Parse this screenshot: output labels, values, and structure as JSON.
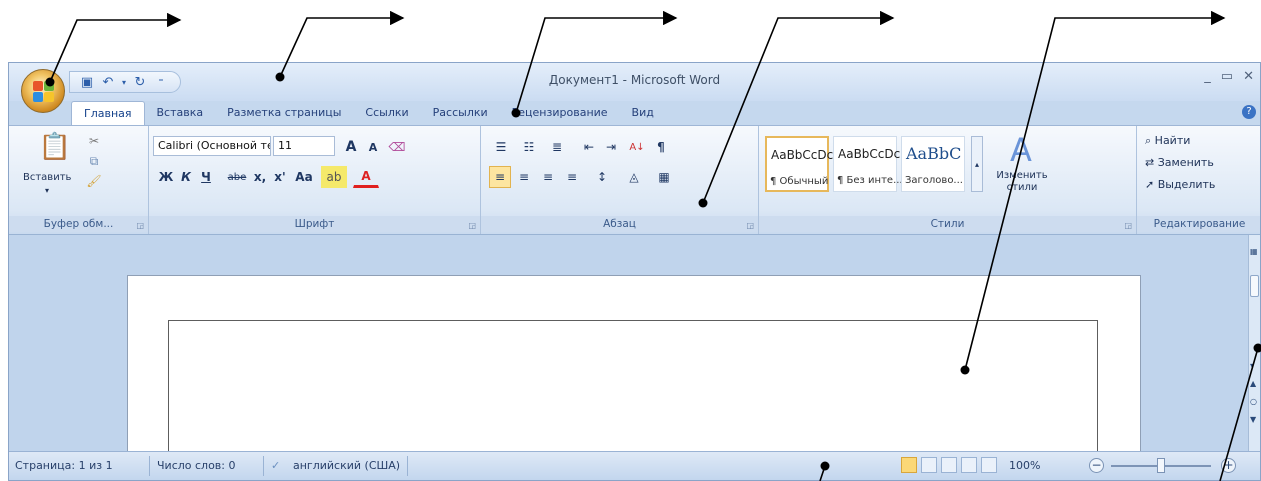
{
  "window": {
    "title": "Документ1 - Microsoft Word",
    "controls": [
      "_",
      "▭",
      "✕"
    ]
  },
  "qat": {
    "icons": [
      "save-icon",
      "undo-icon",
      "redo-icon",
      "customize-icon"
    ]
  },
  "tabs": [
    {
      "label": "Главная",
      "active": true
    },
    {
      "label": "Вставка"
    },
    {
      "label": "Разметка страницы"
    },
    {
      "label": "Ссылки"
    },
    {
      "label": "Рассылки"
    },
    {
      "label": "Рецензирование"
    },
    {
      "label": "Вид"
    }
  ],
  "ribbon": {
    "clipboard": {
      "paste": "Вставить",
      "label": "Буфер обм..."
    },
    "font": {
      "name": "Calibri (Основной те",
      "size": "11",
      "grow": "A",
      "shrink": "A",
      "bold": "Ж",
      "italic": "К",
      "underline": "Ч",
      "strike": "abe",
      "subscript": "x,",
      "superscript": "x'",
      "case": "Aa",
      "label": "Шрифт"
    },
    "paragraph": {
      "label": "Абзац",
      "pilcrow": "¶"
    },
    "styles": {
      "items": [
        {
          "sample": "AaBbCcDc",
          "name": "¶ Обычный"
        },
        {
          "sample": "AaBbCcDc",
          "name": "¶ Без инте..."
        },
        {
          "sample": "AaBbC",
          "name": "Заголово..."
        }
      ],
      "change": "Изменить стили",
      "label": "Стили"
    },
    "editing": {
      "find": "Найти",
      "replace": "Заменить",
      "select": "Выделить",
      "label": "Редактирование"
    }
  },
  "status": {
    "page": "Страница: 1 из 1",
    "words": "Число слов: 0",
    "language": "английский (США)",
    "zoom": "100%"
  }
}
